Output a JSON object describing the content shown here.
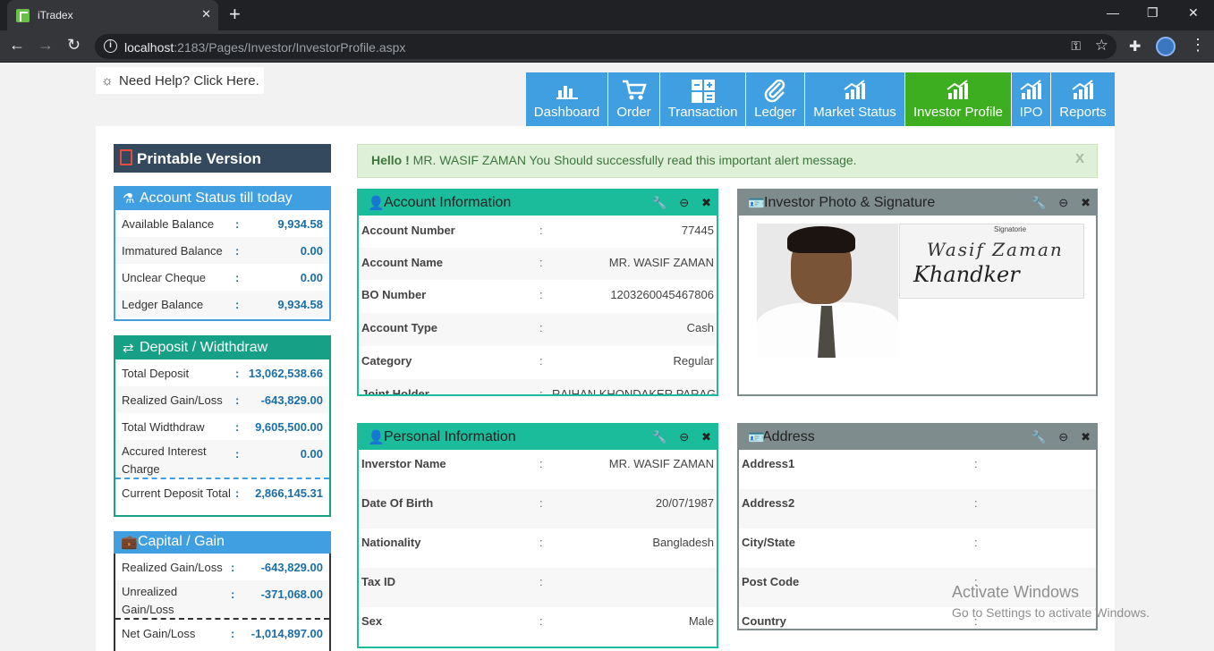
{
  "browser": {
    "tab_title": "iTradex",
    "url_host": "localhost",
    "url_path": ":2183/Pages/Investor/InvestorProfile.aspx"
  },
  "help": {
    "label": "Need Help? Click Here."
  },
  "nav": {
    "items": [
      {
        "label": "Dashboard",
        "icon": "bar-chart-icon"
      },
      {
        "label": "Order",
        "icon": "cart-icon"
      },
      {
        "label": "Transaction",
        "icon": "calculator-icon"
      },
      {
        "label": "Ledger",
        "icon": "paperclip-icon"
      },
      {
        "label": "Market Status",
        "icon": "growth-chart-icon"
      },
      {
        "label": "Investor Profile",
        "icon": "growth-chart-icon",
        "active": true
      },
      {
        "label": "IPO",
        "icon": "growth-chart-icon"
      },
      {
        "label": "Reports",
        "icon": "growth-chart-icon"
      }
    ]
  },
  "printable": {
    "label": "Printable Version"
  },
  "account_status": {
    "title": "Account Status till today",
    "rows": [
      {
        "label": "Available Balance",
        "value": "9,934.58"
      },
      {
        "label": "Immatured Balance",
        "value": "0.00"
      },
      {
        "label": "Unclear Cheque",
        "value": "0.00"
      },
      {
        "label": "Ledger Balance",
        "value": "9,934.58"
      }
    ]
  },
  "deposit": {
    "title": "Deposit / Widthdraw",
    "rows": [
      {
        "label": "Total Deposit",
        "value": "13,062,538.66"
      },
      {
        "label": "Realized Gain/Loss",
        "value": "-643,829.00"
      },
      {
        "label": "Total Widthdraw",
        "value": "9,605,500.00"
      },
      {
        "label": "Accured Interest Charge",
        "value": "0.00"
      },
      {
        "label": "Current Deposit Total",
        "value": "2,866,145.31"
      }
    ]
  },
  "capital": {
    "title": "Capital / Gain",
    "rows": [
      {
        "label": "Realized Gain/Loss",
        "value": "-643,829.00"
      },
      {
        "label": "Unrealized Gain/Loss",
        "value": "-371,068.00"
      },
      {
        "label": "Net Gain/Loss",
        "value": "-1,014,897.00"
      }
    ]
  },
  "alert": {
    "strong": "Hello !",
    "message": "MR. WASIF ZAMAN You Should successfully read this important alert message.",
    "close": "X"
  },
  "account_info": {
    "title": "Account Information",
    "rows": [
      {
        "label": "Account Number",
        "value": "77445"
      },
      {
        "label": "Account Name",
        "value": "MR. WASIF ZAMAN"
      },
      {
        "label": "BO Number",
        "value": "1203260045467806"
      },
      {
        "label": "Account Type",
        "value": "Cash"
      },
      {
        "label": "Category",
        "value": "Regular"
      },
      {
        "label": "Joint Holder",
        "value": "RAIHAN KHONDAKER PARAG"
      }
    ]
  },
  "photo_panel": {
    "title": "Investor Photo & Signature",
    "signature_label": "Signatorie",
    "signature_line1": "Wasif Zaman",
    "signature_line2": "Khandker"
  },
  "personal_info": {
    "title": "Personal Information",
    "rows": [
      {
        "label": "Inverstor Name",
        "value": "MR. WASIF ZAMAN"
      },
      {
        "label": "Date Of Birth",
        "value": "20/07/1987"
      },
      {
        "label": "Nationality",
        "value": "Bangladesh"
      },
      {
        "label": "Tax ID",
        "value": ""
      },
      {
        "label": "Sex",
        "value": "Male"
      }
    ]
  },
  "address": {
    "title": "Address",
    "rows": [
      {
        "label": "Address1",
        "value": ""
      },
      {
        "label": "Address2",
        "value": ""
      },
      {
        "label": "City/State",
        "value": ""
      },
      {
        "label": "Post Code",
        "value": ""
      },
      {
        "label": "Country",
        "value": ""
      }
    ]
  },
  "separator": ":",
  "watermark": {
    "line1": "Activate Windows",
    "line2": "Go to Settings to activate Windows."
  },
  "colors": {
    "nav_blue": "#3f9fe1",
    "nav_active": "#3cae1f",
    "teal": "#1abc9c",
    "gray_panel": "#7f8c8d",
    "dark_header": "#34495e"
  }
}
